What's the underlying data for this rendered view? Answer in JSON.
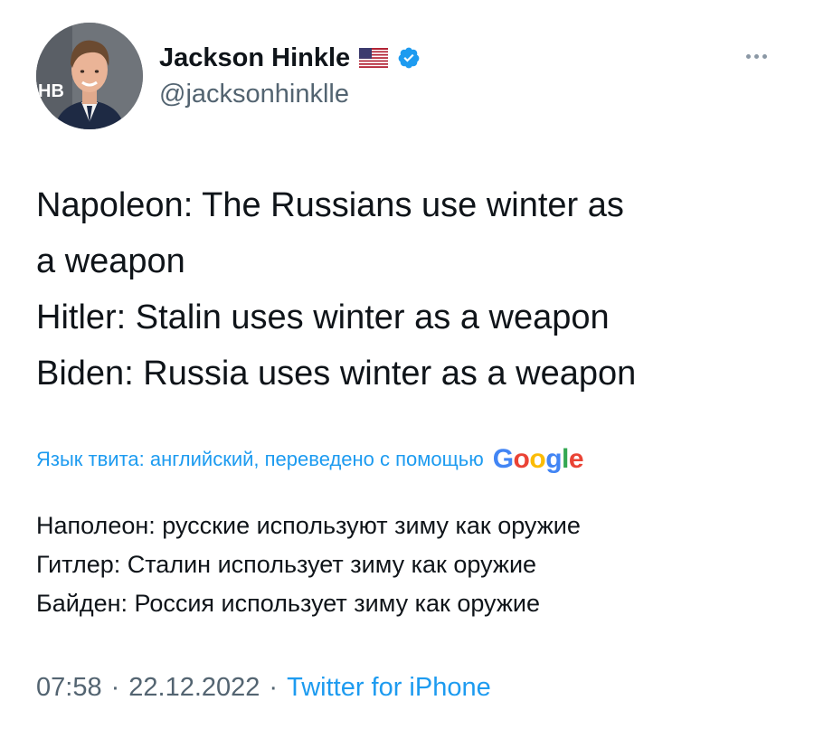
{
  "author": {
    "display_name": "Jackson Hinkle",
    "handle": "@jacksonhinklle",
    "avatar_backdrop_text": "HB",
    "flag_icon": "us-flag-icon",
    "verified_icon": "verified-badge-icon"
  },
  "menu": {
    "more_icon": "more-options-icon"
  },
  "tweet": {
    "lines": [
      "Napoleon: The Russians use winter as",
      "a weapon",
      "Hitler: Stalin uses winter as a weapon",
      "Biden: Russia uses winter as a weapon"
    ]
  },
  "translation": {
    "label": "Язык твита: английский, переведено с помощью",
    "provider_letters": [
      "G",
      "o",
      "o",
      "g",
      "l",
      "e"
    ],
    "provider_colors": [
      "#4285f4",
      "#ea4335",
      "#fbbc05",
      "#4285f4",
      "#34a853",
      "#ea4335"
    ],
    "lines": [
      "Наполеон: русские используют зиму как оружие",
      "Гитлер: Сталин использует зиму как оружие",
      "Байден: Россия использует зиму как оружие"
    ]
  },
  "meta": {
    "time": "07:58",
    "separator": "·",
    "date": "22.12.2022",
    "source": "Twitter for iPhone"
  },
  "colors": {
    "accent": "#1d9bf0",
    "text": "#0f1419",
    "muted": "#536471"
  }
}
